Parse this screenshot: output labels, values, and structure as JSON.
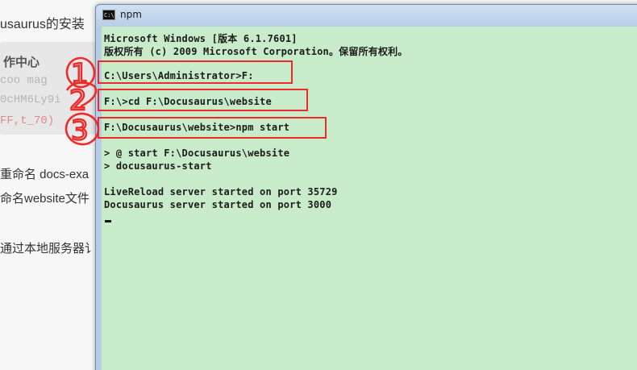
{
  "background": {
    "heading": "usaurus的安装",
    "panel_title": "作中心",
    "blur_lines": [
      "coo  mag",
      "0cHM6Ly9i",
      "FF,t_70)"
    ],
    "lines": [
      "重命名 docs-exa",
      "命名website文件",
      "通过本地服务器讠"
    ]
  },
  "window": {
    "title": "npm",
    "icon": "cmd-icon",
    "icon_glyph": "C:\\"
  },
  "console": {
    "lines": [
      "Microsoft Windows [版本 6.1.7601]",
      "版权所有 (c) 2009 Microsoft Corporation。保留所有权利。",
      "",
      "C:\\Users\\Administrator>F:",
      "",
      "F:\\>cd F:\\Docusaurus\\website",
      "",
      "F:\\Docusaurus\\website>npm start",
      "",
      "> @ start F:\\Docusaurus\\website",
      "> docusaurus-start",
      "",
      "LiveReload server started on port 35729",
      "Docusaurus server started on port 3000"
    ]
  },
  "annotations": {
    "color": "#ee2a2a",
    "labels": [
      "1",
      "2",
      "3"
    ]
  }
}
